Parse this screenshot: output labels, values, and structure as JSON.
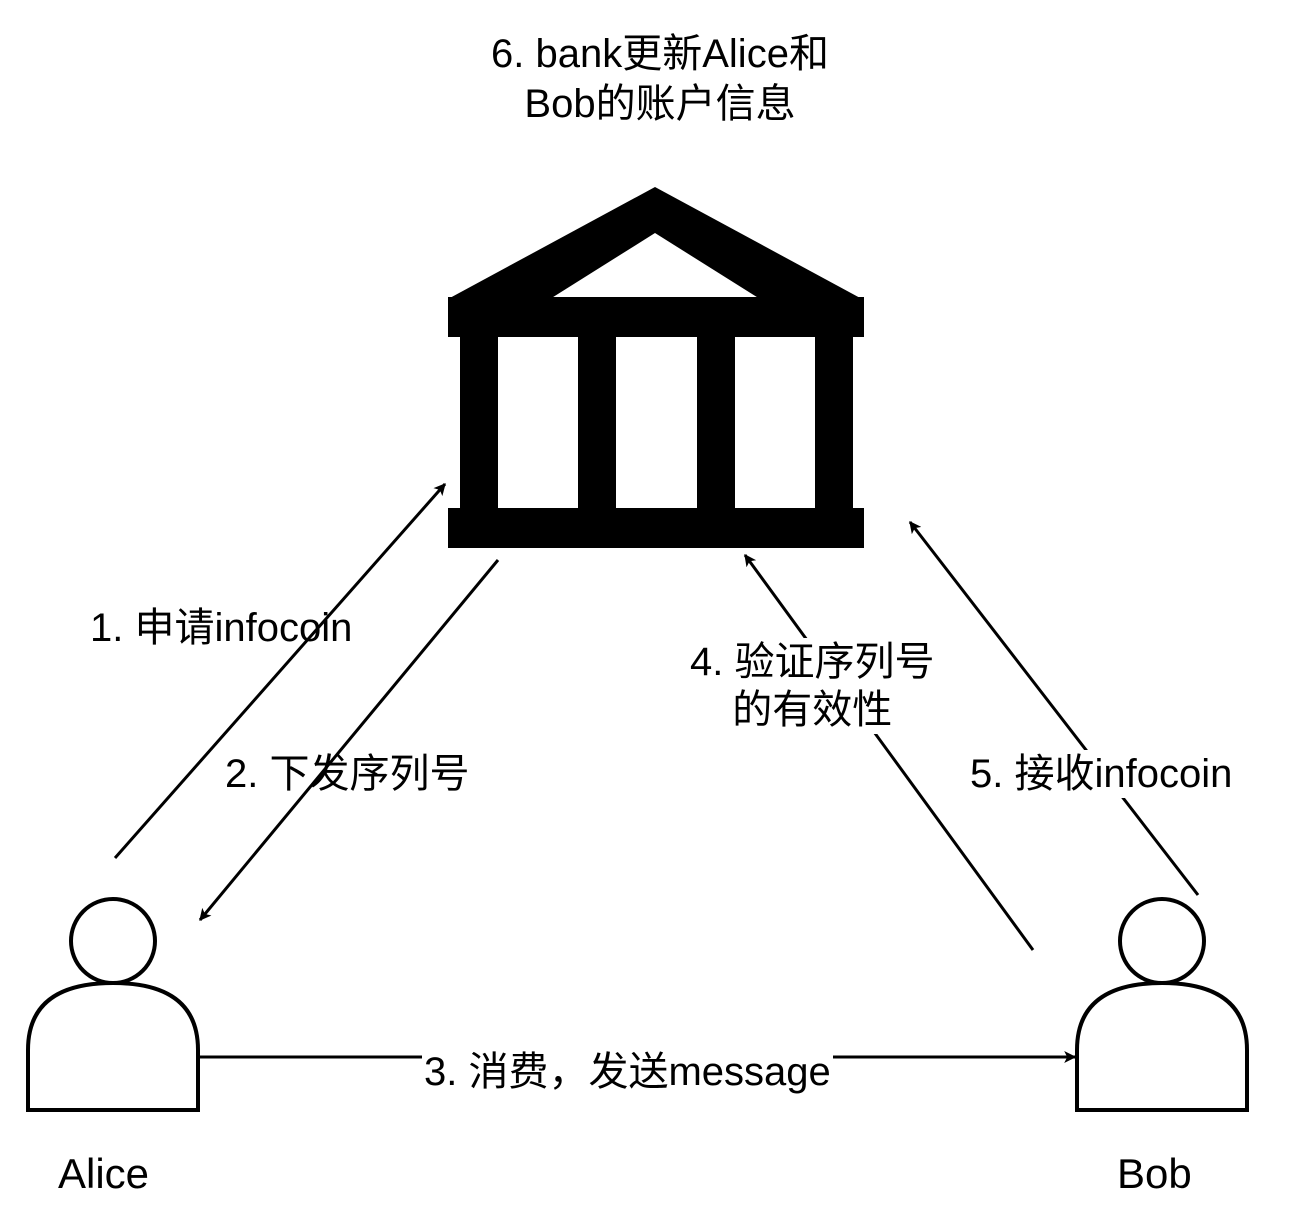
{
  "bank": {
    "update_line1": "6. bank更新Alice和",
    "update_line2": "Bob的账户信息"
  },
  "steps": {
    "step1": "1. 申请infocoin",
    "step2": "2. 下发序列号",
    "step3": "3. 消费，发送message",
    "step4_line1": "4. 验证序列号",
    "step4_line2": "的有效性",
    "step5": "5. 接收infocoin"
  },
  "actors": {
    "alice": "Alice",
    "bob": "Bob"
  },
  "icons": {
    "bank": "bank-icon",
    "user": "user-icon"
  },
  "colors": {
    "stroke": "#000000",
    "background": "#ffffff"
  }
}
